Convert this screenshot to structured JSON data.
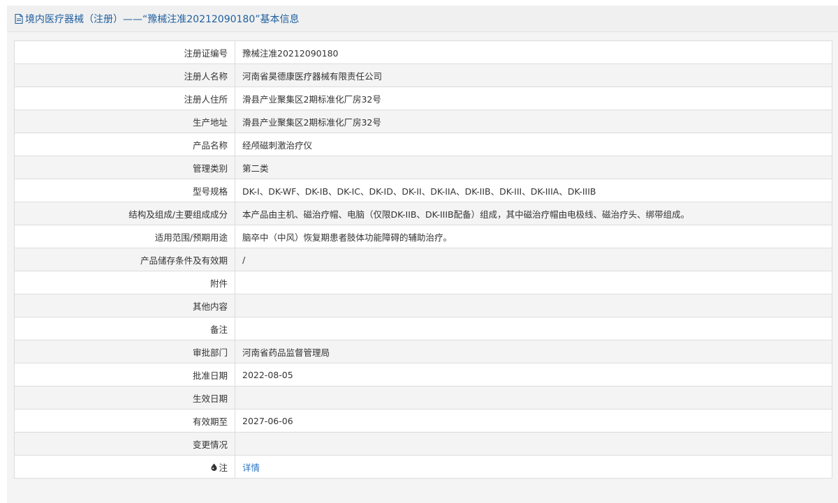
{
  "header": {
    "icon": "document-icon",
    "title": "境内医疗器械（注册）——“豫械注准20212090180”基本信息"
  },
  "rows": [
    {
      "label": "注册证编号",
      "value": "豫械注准20212090180"
    },
    {
      "label": "注册人名称",
      "value": "河南省昊德康医疗器械有限责任公司"
    },
    {
      "label": "注册人住所",
      "value": "滑县产业聚集区2期标准化厂房32号"
    },
    {
      "label": "生产地址",
      "value": "滑县产业聚集区2期标准化厂房32号"
    },
    {
      "label": "产品名称",
      "value": "经颅磁刺激治疗仪"
    },
    {
      "label": "管理类别",
      "value": "第二类"
    },
    {
      "label": "型号规格",
      "value": "DK-I、DK-WF、DK-IB、DK-IC、DK-ID、DK-II、DK-IIA、DK-IIB、DK-III、DK-IIIA、DK-IIIB"
    },
    {
      "label": "结构及组成/主要组成成分",
      "value": "本产品由主机、磁治疗帽、电脑（仅限DK-IIB、DK-IIIB配备）组成，其中磁治疗帽由电极线、磁治疗头、绑带组成。"
    },
    {
      "label": "适用范围/预期用途",
      "value": "脑卒中（中风）恢复期患者肢体功能障碍的辅助治疗。"
    },
    {
      "label": "产品储存条件及有效期",
      "value": "/"
    },
    {
      "label": "附件",
      "value": ""
    },
    {
      "label": "其他内容",
      "value": ""
    },
    {
      "label": "备注",
      "value": ""
    },
    {
      "label": "审批部门",
      "value": "河南省药品监督管理局"
    },
    {
      "label": "批准日期",
      "value": "2022-08-05"
    },
    {
      "label": "生效日期",
      "value": ""
    },
    {
      "label": "有效期至",
      "value": "2027-06-06"
    },
    {
      "label": "变更情况",
      "value": ""
    }
  ],
  "note_row": {
    "icon": "drop-icon",
    "label": "注",
    "link_text": "详情"
  },
  "colors": {
    "header_text": "#1e5f9e",
    "link": "#2a74c5",
    "border": "#dcdcdc",
    "row_alt": "#f4f4f4"
  }
}
